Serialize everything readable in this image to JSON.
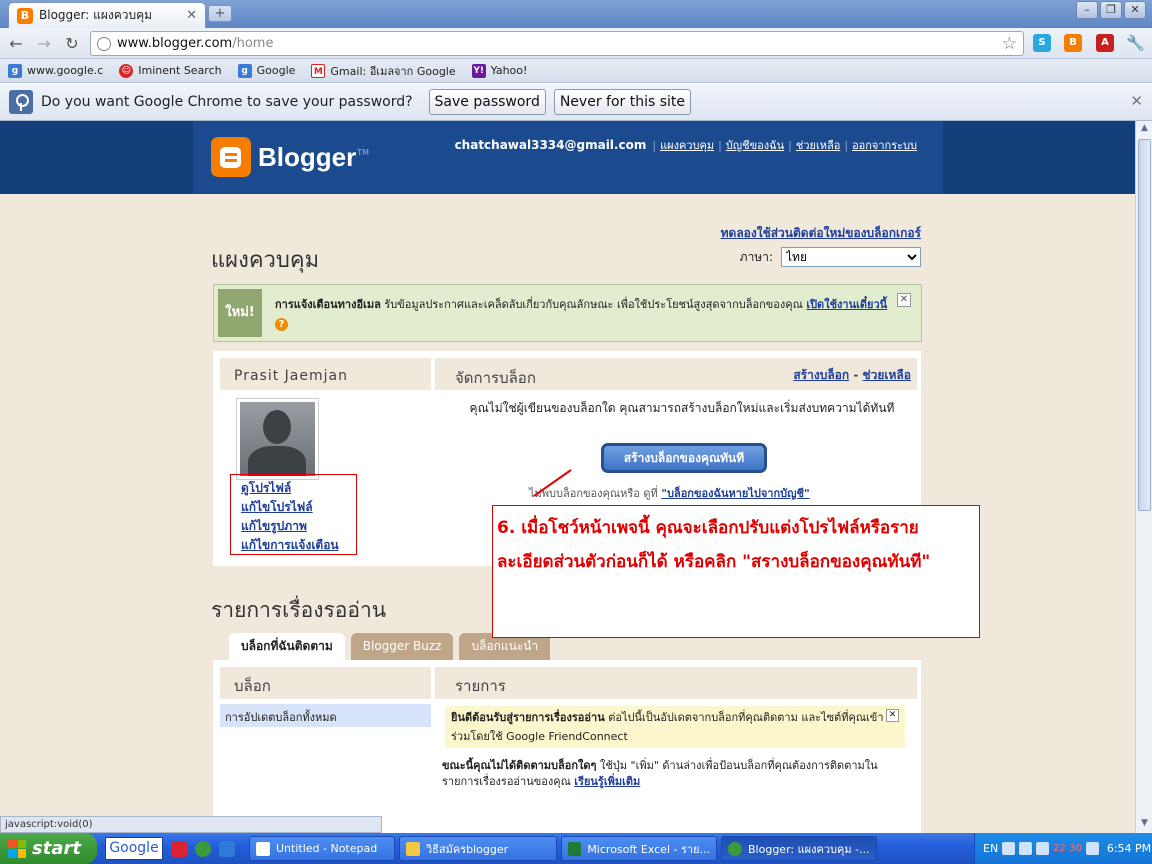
{
  "browser": {
    "tab_title": "Blogger: แผงควบคุม",
    "url_host": "www.blogger.com",
    "url_path": "/home",
    "bookmarks": [
      {
        "label": "www.google.c"
      },
      {
        "label": "Iminent Search"
      },
      {
        "label": "Google"
      },
      {
        "label": "Gmail: อีเมลจาก Google"
      },
      {
        "label": "Yahoo!"
      }
    ],
    "infobar": {
      "message": "Do you want Google Chrome to save your password?",
      "save_label": "Save password",
      "never_label": "Never for this site"
    },
    "status_text": "javascript:void(0)"
  },
  "blogger": {
    "logo_text": "Blogger",
    "logo_tm": "TM",
    "user_email": "chatchawal3334@gmail.com",
    "nav": [
      "แผงควบคุม",
      "บัญชีของฉัน",
      "ช่วยเหลือ",
      "ออกจากระบบ"
    ],
    "try_link": "ทดลองใช้ส่วนติดต่อใหม่ของบล็อกเกอร์",
    "page_title": "แผงควบคุม",
    "language_label": "ภาษา:",
    "language_value": "ไทย",
    "notice": {
      "badge": "ใหม่!",
      "bold": "การแจ้งเตือนทางอีเมล",
      "text": " รับข้อมูลประกาศและเคล็ดลับเกี่ยวกับคุณลักษณะ เพื่อใช้ประโยชน์สูงสุดจากบล็อกของคุณ ",
      "link": "เปิดใช้งานเดี๋ยวนี้"
    },
    "profile": {
      "name": "Prasit Jaemjan",
      "links": [
        "ดูโปรไฟล์",
        "แก้ไขโปรไฟล์",
        "แก้ไขรูปภาพ",
        "แก้ไขการแจ้งเตือน"
      ]
    },
    "manage": {
      "title": "จัดการบล็อก",
      "create_link": "สร้างบล็อก",
      "help_link": "ช่วยเหลือ",
      "no_blog_text": "คุณไม่ใช่ผู้เขียนของบล็อกใด คุณสามารถสร้างบล็อกใหม่และเริ่มส่งบทความได้ทันที",
      "create_button": "สร้างบล็อกของคุณทันที",
      "missing_text": "ไม่พบบล็อกของคุณหรือ ดูที่ ",
      "missing_link": "\"บล็อกของฉันหายไปจากบัญชี\""
    },
    "reading_list": {
      "title": "รายการเรื่องรออ่าน",
      "tabs": [
        "บล็อกที่ฉันติดตาม",
        "Blogger Buzz",
        "บล็อกแนะนำ"
      ],
      "col_blogs": "บล็อก",
      "col_items": "รายการ",
      "item_all": "การอัปเดตบล็อกทั้งหมด",
      "welcome_bold": "ยินดีต้อนรับสู่รายการเรื่องรออ่าน",
      "welcome_text": " ต่อไปนี้เป็นอัปเดตจากบล็อกที่คุณติดตาม และไซต์ที่คุณเข้าร่วมโดยใช้ Google FriendConnect",
      "not_following_bold": "ขณะนี้คุณไม่ได้ติดตามบล็อกใดๆ",
      "not_following_text": " ใช้ปุ่ม \"เพิ่ม\" ด้านล่างเพื่อป้อนบล็อกที่คุณต้องการติดตามในรายการเรื่องรออ่านของคุณ ",
      "learn_more": "เรียนรู้เพิ่มเติม"
    }
  },
  "annotation": {
    "text": "6. เมื่อโชว์หน้าเพจนี้ คุณจะเลือกปรับแต่งโปรไฟล์หรือรายละเอียดส่วนตัวก่อนก็ได้ หรือคลิก \"สรางบล็อกของคุณทันที\""
  },
  "taskbar": {
    "start_label": "start",
    "google_label": "Google",
    "tasks": [
      "Untitled - Notepad",
      "วิธีสมัครblogger",
      "Microsoft Excel - ราย...",
      "Blogger: แผงควบคุม -..."
    ],
    "lang": "EN",
    "clock": "6:54 PM",
    "tray_numbers": "22 30"
  },
  "colors": {
    "header_blue": "#1b4b8e",
    "page_beige": "#f1e8dc",
    "blogger_orange": "#f57d00",
    "annotation_red": "#e00000"
  }
}
